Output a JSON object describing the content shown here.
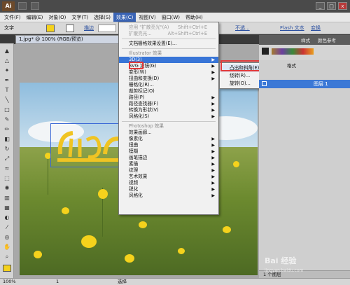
{
  "app": {
    "logo": "Ai"
  },
  "menubar": [
    "文件(F)",
    "编辑(E)",
    "对象(O)",
    "文字(T)",
    "选择(S)",
    "效果(C)",
    "视图(V)",
    "窗口(W)",
    "帮助(H)"
  ],
  "menubar_active_index": 5,
  "controlbar": {
    "label": "文字",
    "stroke_label": "描边",
    "opacity_label": "不透...",
    "flash_label": "Flash 文本",
    "transform_label": "变换"
  },
  "document": {
    "tab": "1.jpg* @ 100% (RGB/预览)"
  },
  "effect_menu": {
    "items": [
      {
        "label": "应用 \"扩散亮光\"(A)",
        "shortcut": "Shift+Ctrl+E",
        "disabled": true
      },
      {
        "label": "扩散亮光...",
        "shortcut": "Alt+Shift+Ctrl+E",
        "disabled": true
      },
      {
        "sep": true
      },
      {
        "label": "文档栅格效果设置(E)..."
      },
      {
        "sep": true
      },
      {
        "label": "Illustrator 效果",
        "header": true
      },
      {
        "label": "3D(3)",
        "arrow": true,
        "highlight": true
      },
      {
        "label": "SVG 滤镜(G)",
        "arrow": true
      },
      {
        "label": "变形(W)",
        "arrow": true
      },
      {
        "label": "扭曲和变换(D)",
        "arrow": true
      },
      {
        "label": "栅格化(R)..."
      },
      {
        "label": "裁剪标记(O)"
      },
      {
        "label": "路径(P)",
        "arrow": true
      },
      {
        "label": "路径查找器(F)",
        "arrow": true
      },
      {
        "label": "转换为形状(V)",
        "arrow": true
      },
      {
        "label": "风格化(S)",
        "arrow": true
      },
      {
        "sep": true
      },
      {
        "label": "Photoshop 效果",
        "header": true
      },
      {
        "label": "效果画廊..."
      },
      {
        "label": "像素化",
        "arrow": true
      },
      {
        "label": "扭曲",
        "arrow": true
      },
      {
        "label": "模糊",
        "arrow": true
      },
      {
        "label": "画笔描边",
        "arrow": true
      },
      {
        "label": "素描",
        "arrow": true
      },
      {
        "label": "纹理",
        "arrow": true
      },
      {
        "label": "艺术效果",
        "arrow": true
      },
      {
        "label": "视频",
        "arrow": true
      },
      {
        "label": "锐化",
        "arrow": true
      },
      {
        "label": "风格化",
        "arrow": true
      }
    ]
  },
  "submenu_3d": {
    "items": [
      {
        "label": "凸出和斜角(E)...",
        "highlight": true
      },
      {
        "label": "绕转(R)..."
      },
      {
        "label": "旋转(O)..."
      }
    ]
  },
  "panels": {
    "tabs": [
      "样式",
      "颜色参考"
    ],
    "layers_tab": "格式",
    "layer_name": "图层 1",
    "layer_count": "1 个图层"
  },
  "statusbar": {
    "zoom": "100%",
    "page": "1",
    "mode": "选择"
  },
  "watermark": {
    "text": "Bai 经验",
    "sub": "jingyan.baidu.com"
  },
  "colors": {
    "accent": "#3875d7",
    "highlight_box": "#e23a3a",
    "layer_row": "#3b78d6"
  }
}
